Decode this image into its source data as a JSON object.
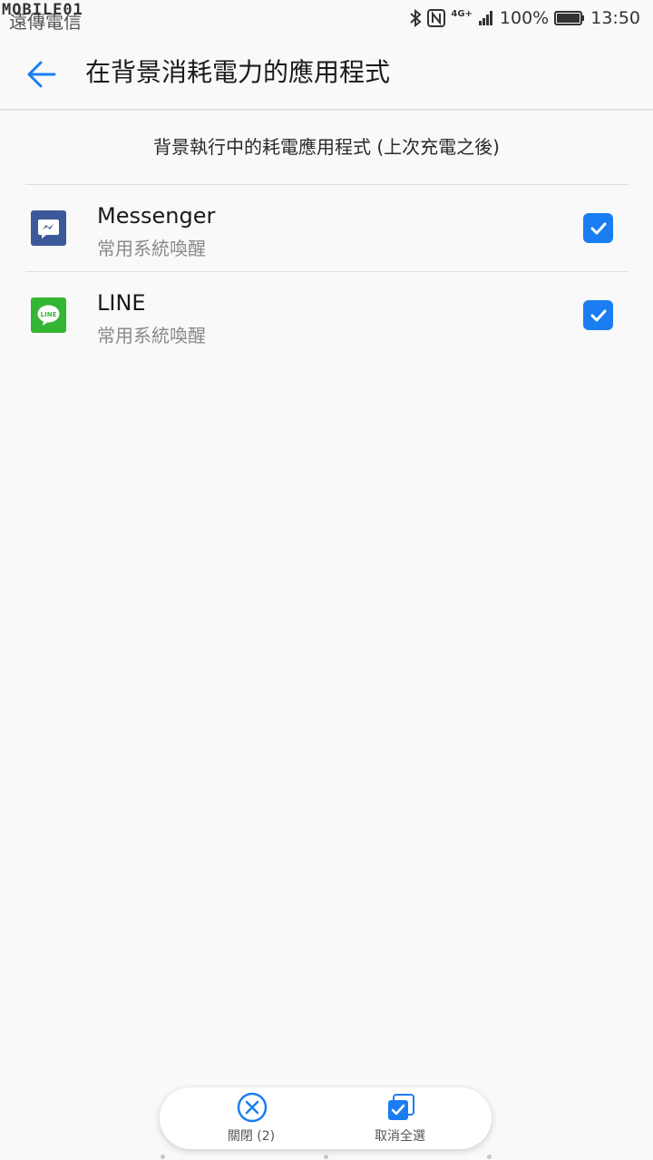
{
  "status_bar": {
    "carrier": "遠傳電信",
    "watermark": "MOBILE01",
    "network": "4G+",
    "battery": "100%",
    "time": "13:50"
  },
  "header": {
    "title": "在背景消耗電力的應用程式"
  },
  "section": {
    "title": "背景執行中的耗電應用程式 (上次充電之後)"
  },
  "apps": [
    {
      "name": "Messenger",
      "subtitle": "常用系統喚醒",
      "checked": true,
      "icon": "messenger-icon",
      "icon_color": "#3b5998"
    },
    {
      "name": "LINE",
      "subtitle": "常用系統喚醒",
      "checked": true,
      "icon": "line-icon",
      "icon_color": "#35b534",
      "icon_text": "LINE"
    }
  ],
  "actions": {
    "close_label": "關閉 (2)",
    "deselect_all_label": "取消全選"
  },
  "colors": {
    "accent": "#1a7ef2",
    "back_arrow": "#1a7ef2"
  }
}
